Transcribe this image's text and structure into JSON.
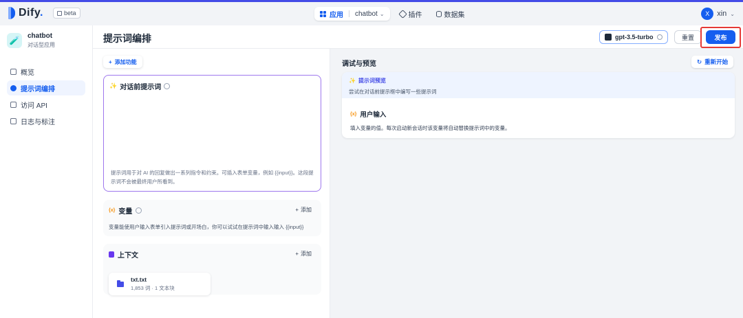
{
  "brand": {
    "name": "Dify",
    "dot": ".",
    "badge": "beta"
  },
  "nav": {
    "apps_label": "应用",
    "current_app": "chatbot",
    "plugins_label": "插件",
    "datasets_label": "数据集"
  },
  "user": {
    "initial": "X",
    "name": "xin"
  },
  "app": {
    "name": "chatbot",
    "type": "对话型应用"
  },
  "sidebar": {
    "items": [
      {
        "label": "概览",
        "icon": "overview-icon"
      },
      {
        "label": "提示词编排",
        "icon": "prompt-icon"
      },
      {
        "label": "访问 API",
        "icon": "api-icon"
      },
      {
        "label": "日志与标注",
        "icon": "logs-icon"
      }
    ]
  },
  "header": {
    "title": "提示词编排",
    "model": "gpt-3.5-turbo",
    "reset_label": "重置",
    "publish_label": "发布"
  },
  "config": {
    "add_feature_label": "添加功能",
    "prompt_title": "对话前提示词",
    "prompt_placeholder": "提示词用于对 AI 的回复做出一系列指令和约束。可插入表单变量，例如 {{input}}。这段提示词不会被最终用户所看到。",
    "variables": {
      "title": "变量",
      "add_label": "添加",
      "description": "变量能使用户输入表单引入提示词或开场白，你可以试试在提示词中输入输入 {{input}}"
    },
    "context": {
      "title": "上下文",
      "add_label": "添加",
      "file_name": "txt.txt",
      "file_meta": "1,853 词 · 1 文本块"
    }
  },
  "preview": {
    "title": "调试与预览",
    "restart_label": "重新开始",
    "prompt_preview_title": "提示词预览",
    "prompt_preview_desc": "尝试在对话前提示框中编写一些提示词",
    "user_input_title": "用户输入",
    "user_input_desc": "填入变量的值。每次启动新会话时该变量将自动替换提示词中的变量。"
  },
  "colors": {
    "accent": "#155eef",
    "prompt_border": "#9e77ed",
    "highlight": "#e53935"
  }
}
